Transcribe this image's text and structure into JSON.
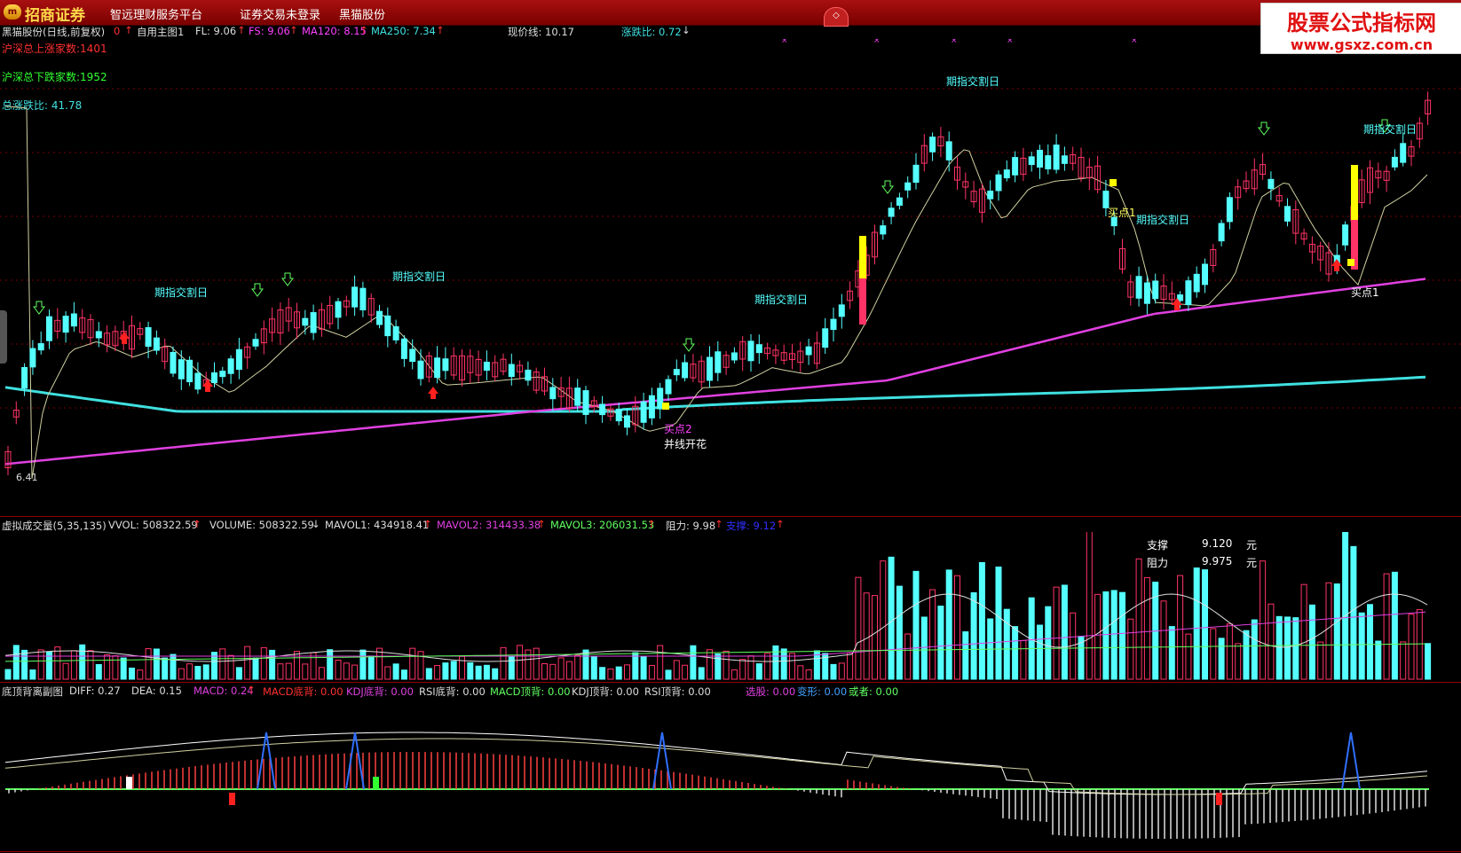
{
  "titlebar": {
    "logo_badge": "m",
    "brand": "招商证券",
    "menu": [
      "智远理财服务平台",
      "证券交易未登录",
      "黑猫股份"
    ],
    "center_button": "◇"
  },
  "watermark": {
    "line1": "股票公式指标网",
    "line2": "www.gsxz.com.cn"
  },
  "main_header": {
    "stock_name": "黑猫股份(日线,前复权)",
    "zero_mark": "0",
    "formula": "自用主图1",
    "fl": "FL: 9.06",
    "fs": "FS: 9.06",
    "ma120": "MA120: 8.15",
    "ma250": "MA250: 7.34",
    "price_line": "现价线: 10.17",
    "updown_ratio": "涨跌比: 0.72"
  },
  "market_stats": {
    "up_count": "沪深总上涨家数:1401",
    "down_count": "沪深总下跌家数:1952",
    "ratio": "总涨跌比: 41.78"
  },
  "annotations": {
    "futures_day": "期指交割日",
    "buy1": "买点1",
    "buy2": "买点2",
    "lines_bloom": "并线开花",
    "low_price": "6.41"
  },
  "volume_header": {
    "name": "虚拟成交量(5,35,135)",
    "vvol": "VVOL: 508322.59",
    "volume": "VOLUME: 508322.59",
    "mavol1": "MAVOL1: 434918.41",
    "mavol2": "MAVOL2: 314433.38",
    "mavol3": "MAVOL3: 206031.53",
    "resistance": "阻力: 9.98",
    "support": "支撑: 9.12"
  },
  "volume_info": {
    "support_label": "支撑",
    "support_value": "9.120",
    "support_unit": "元",
    "resist_label": "阻力",
    "resist_value": "9.975",
    "resist_unit": "元"
  },
  "macd_header": {
    "name": "底顶背离副图",
    "diff": "DIFF: 0.27",
    "dea": "DEA: 0.15",
    "macd": "MACD: 0.24",
    "macd_bottom": "MACD底背: 0.00",
    "kdj_bottom": "KDJ底背: 0.00",
    "rsi_bottom": "RSI底背: 0.00",
    "macd_top": "MACD顶背: 0.00",
    "kdj_top": "KDJ顶背: 0.00",
    "rsi_top": "RSI顶背: 0.00",
    "select": "选股: 0.00",
    "transform": "变形: 0.00",
    "or": "或者: 0.00"
  },
  "colors": {
    "up": "#ff3366",
    "down": "#55ffff",
    "ma_slow": "#e040e0",
    "ma_long": "#40e0e0",
    "ma_short": "#d0d0a0",
    "signal_yellow": "#ffff00"
  }
}
